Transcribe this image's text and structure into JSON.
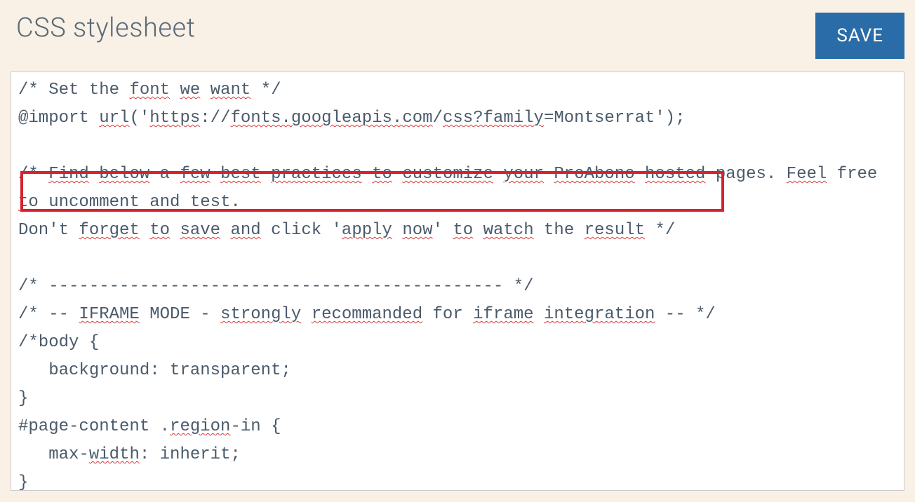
{
  "panel": {
    "title": "CSS stylesheet",
    "save_label": "SAVE"
  },
  "editor": {
    "line1_a": "/* Set the ",
    "line1_b": "font",
    "line1_c": " ",
    "line1_d": "we",
    "line1_e": " ",
    "line1_f": "want",
    "line1_g": " */",
    "line2_a": "@import ",
    "line2_b": "url",
    "line2_c": "('",
    "line2_d": "https",
    "line2_e": "://",
    "line2_f": "fonts.googleapis.com",
    "line2_g": "/",
    "line2_h": "css?family",
    "line2_i": "=Montserrat');",
    "line3": "",
    "line4_a": "/* ",
    "line4_b": "Find",
    "line4_c": " ",
    "line4_d": "below",
    "line4_e": " a ",
    "line4_f": "few",
    "line4_g": " ",
    "line4_h": "best",
    "line4_i": " ",
    "line4_j": "practices",
    "line4_k": " ",
    "line4_l": "to",
    "line4_m": " ",
    "line4_n": "customize",
    "line4_o": " ",
    "line4_p": "your",
    "line4_q": " ",
    "line4_r": "ProAbono",
    "line4_s": " ",
    "line4_t": "hosted",
    "line4_u": " pages. ",
    "line4_v": "Feel",
    "line5_a": " free ",
    "line5_b": "to",
    "line5_c": " ",
    "line5_d": "uncomment",
    "line5_e": " ",
    "line5_f": "and",
    "line5_g": " test.",
    "line6_a": "Don't ",
    "line6_b": "forget",
    "line6_c": " ",
    "line6_d": "to",
    "line6_e": " ",
    "line6_f": "save",
    "line6_g": " ",
    "line6_h": "and",
    "line6_i": " click '",
    "line6_j": "apply",
    "line6_k": " ",
    "line6_l": "now",
    "line6_m": "' ",
    "line6_n": "to",
    "line6_o": " ",
    "line6_p": "watch",
    "line6_q": " the ",
    "line6_r": "result",
    "line6_s": " */",
    "line7": "",
    "line8": "/* --------------------------------------------- */",
    "line9_a": "/* -- ",
    "line9_b": "IFRAME",
    "line9_c": " MODE - ",
    "line9_d": "strongly",
    "line9_e": " ",
    "line9_f": "recommanded",
    "line9_g": " for ",
    "line9_h": "iframe",
    "line9_i": " ",
    "line9_j": "integration",
    "line9_k": " -- */",
    "line10": "/*body {",
    "line11": "   background: transparent;",
    "line12": "}",
    "line13_a": "#page-content .",
    "line13_b": "region",
    "line13_c": "-in {",
    "line14_a": "   max-",
    "line14_b": "width",
    "line14_c": ": inherit;",
    "line15": "}"
  }
}
